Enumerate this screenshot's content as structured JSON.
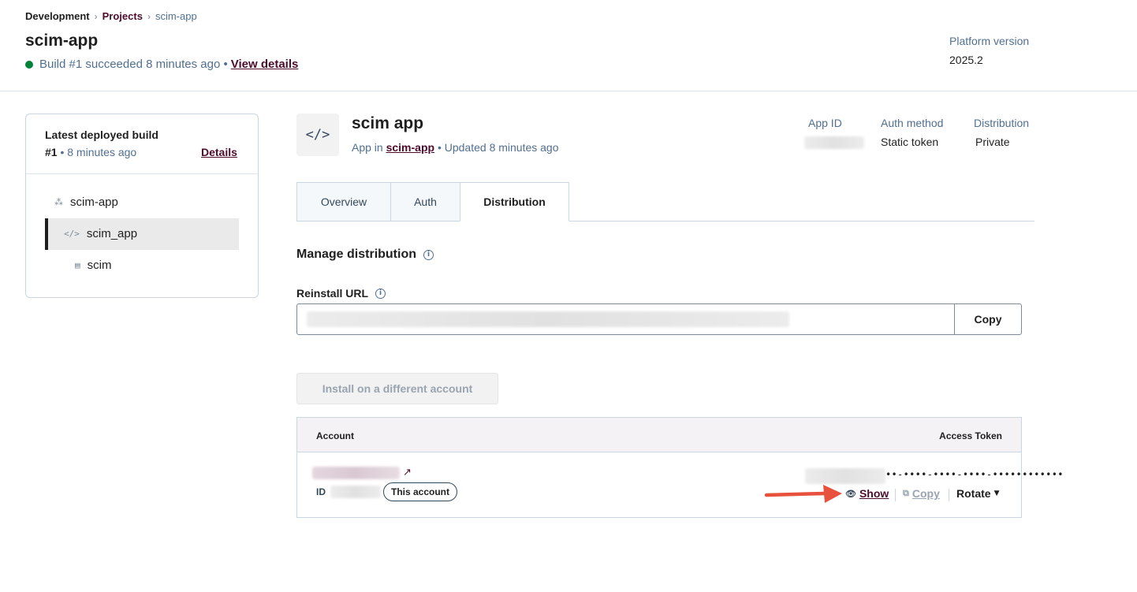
{
  "breadcrumb": {
    "root": "Development",
    "projects": "Projects",
    "current": "scim-app",
    "separator": "›"
  },
  "header": {
    "title": "scim-app",
    "build_status": "Build #1 succeeded 8 minutes ago •",
    "view_details": "View details",
    "platform_label": "Platform version",
    "platform_value": "2025.2",
    "status_color": "#00823b"
  },
  "build_card": {
    "title": "Latest deployed build",
    "build_number": "#1",
    "build_age": " • 8 minutes ago",
    "details_link": "Details",
    "tree": [
      {
        "label": "scim-app",
        "icon": "project-icon"
      },
      {
        "label": "scim_app",
        "icon": "code-icon",
        "selected": true
      },
      {
        "label": "scim",
        "icon": "document-icon"
      }
    ]
  },
  "app": {
    "title": "scim app",
    "subtitle_prefix": "App in ",
    "subtitle_link": "scim-app",
    "subtitle_suffix": " • Updated 8 minutes ago",
    "meta": {
      "app_id_label": "App ID",
      "auth_method_label": "Auth method",
      "auth_method_value": "Static token",
      "distribution_label": "Distribution",
      "distribution_value": "Private"
    }
  },
  "tabs": [
    {
      "label": "Overview",
      "active": false
    },
    {
      "label": "Auth",
      "active": false
    },
    {
      "label": "Distribution",
      "active": true
    }
  ],
  "distribution": {
    "section_title": "Manage distribution",
    "reinstall_label": "Reinstall URL",
    "copy_label": "Copy",
    "install_button": "Install on a different account",
    "table": {
      "col_account": "Account",
      "col_token": "Access Token",
      "row": {
        "id_label": "ID",
        "badge": "This account",
        "token_masked": "••-••••-••••-••••-••••••••••••",
        "show": "Show",
        "copy": "Copy",
        "rotate": "Rotate"
      }
    }
  },
  "colors": {
    "accent": "#4d0c2b",
    "border": "#cbd6e2",
    "annotation_arrow": "#e8513e"
  }
}
